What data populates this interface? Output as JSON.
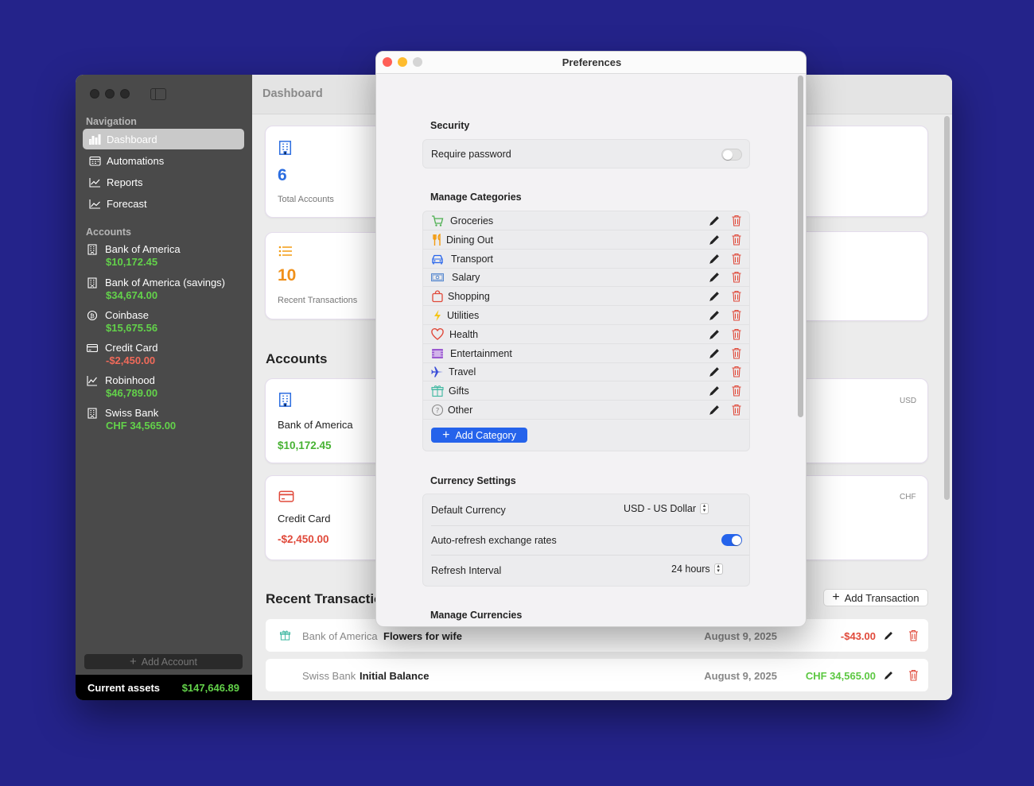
{
  "colors": {
    "background": "#24238a",
    "positive": "#5cc842",
    "negative": "#e0493a",
    "accent": "#2563eb",
    "sidebar": "#4a4a4a"
  },
  "main": {
    "title": "Dashboard",
    "sidebar": {
      "navigation_label": "Navigation",
      "nav": [
        {
          "label": "Dashboard",
          "icon": "bar-chart-icon"
        },
        {
          "label": "Automations",
          "icon": "calendar-icon"
        },
        {
          "label": "Reports",
          "icon": "line-chart-icon"
        },
        {
          "label": "Forecast",
          "icon": "trend-icon"
        }
      ],
      "accounts_label": "Accounts",
      "accounts": [
        {
          "name": "Bank of America",
          "balance": "$10,172.45",
          "icon": "building-icon"
        },
        {
          "name": "Bank of America (savings)",
          "balance": "$34,674.00",
          "icon": "building-icon"
        },
        {
          "name": "Coinbase",
          "balance": "$15,675.56",
          "icon": "bitcoin-icon"
        },
        {
          "name": "Credit Card",
          "balance": "-$2,450.00",
          "icon": "credit-card-icon"
        },
        {
          "name": "Robinhood",
          "balance": "$46,789.00",
          "icon": "chart-icon"
        },
        {
          "name": "Swiss Bank",
          "balance": "CHF 34,565.00",
          "icon": "building-icon"
        }
      ],
      "add_account": "Add Account",
      "current_assets_label": "Current assets",
      "current_assets_value": "$147,646.89"
    },
    "stats": [
      {
        "value": "6",
        "label": "Total Accounts",
        "icon": "building-icon"
      },
      {
        "value": "10",
        "label": "Recent Transactions",
        "icon": "list-icon"
      }
    ],
    "accounts_title": "Accounts",
    "account_cards": [
      {
        "name": "Bank of America",
        "balance": "$10,172.45",
        "icon": "building-icon",
        "currency": "USD"
      },
      {
        "name": "Credit Card",
        "balance": "-$2,450.00",
        "icon": "credit-card-icon",
        "currency": "CHF"
      }
    ],
    "recent_title": "Recent Transactions",
    "add_transaction": "Add Transaction",
    "transactions": [
      {
        "account": "Bank of America",
        "description": "Flowers for wife",
        "date": "August 9, 2025",
        "amount": "-$43.00",
        "icon": "gift-icon"
      },
      {
        "account": "Swiss Bank",
        "description": "Initial Balance",
        "date": "August 9, 2025",
        "amount": "CHF 34,565.00"
      }
    ]
  },
  "prefs": {
    "title": "Preferences",
    "security_title": "Security",
    "require_password": "Require password",
    "require_password_on": false,
    "categories_title": "Manage Categories",
    "categories": [
      {
        "name": "Groceries",
        "icon": "cart-icon",
        "color": "#4caf50"
      },
      {
        "name": "Dining Out",
        "icon": "fork-knife-icon",
        "color": "#f39c12"
      },
      {
        "name": "Transport",
        "icon": "car-icon",
        "color": "#2563eb"
      },
      {
        "name": "Salary",
        "icon": "banknote-icon",
        "color": "#5b8bd0"
      },
      {
        "name": "Shopping",
        "icon": "bag-icon",
        "color": "#e0493a"
      },
      {
        "name": "Utilities",
        "icon": "bolt-icon",
        "color": "#f5c518"
      },
      {
        "name": "Health",
        "icon": "heart-icon",
        "color": "#e0493a"
      },
      {
        "name": "Entertainment",
        "icon": "film-icon",
        "color": "#9b59d0"
      },
      {
        "name": "Travel",
        "icon": "airplane-icon",
        "color": "#3b4fd8"
      },
      {
        "name": "Gifts",
        "icon": "gift-icon",
        "color": "#3cb7a0"
      },
      {
        "name": "Other",
        "icon": "question-icon",
        "color": "#888888"
      }
    ],
    "add_category": "Add Category",
    "currency_title": "Currency Settings",
    "default_currency_label": "Default Currency",
    "default_currency_value": "USD - US Dollar",
    "auto_refresh_label": "Auto-refresh exchange rates",
    "auto_refresh_on": true,
    "refresh_interval_label": "Refresh Interval",
    "refresh_interval_value": "24 hours",
    "manage_currencies_title": "Manage Currencies"
  }
}
